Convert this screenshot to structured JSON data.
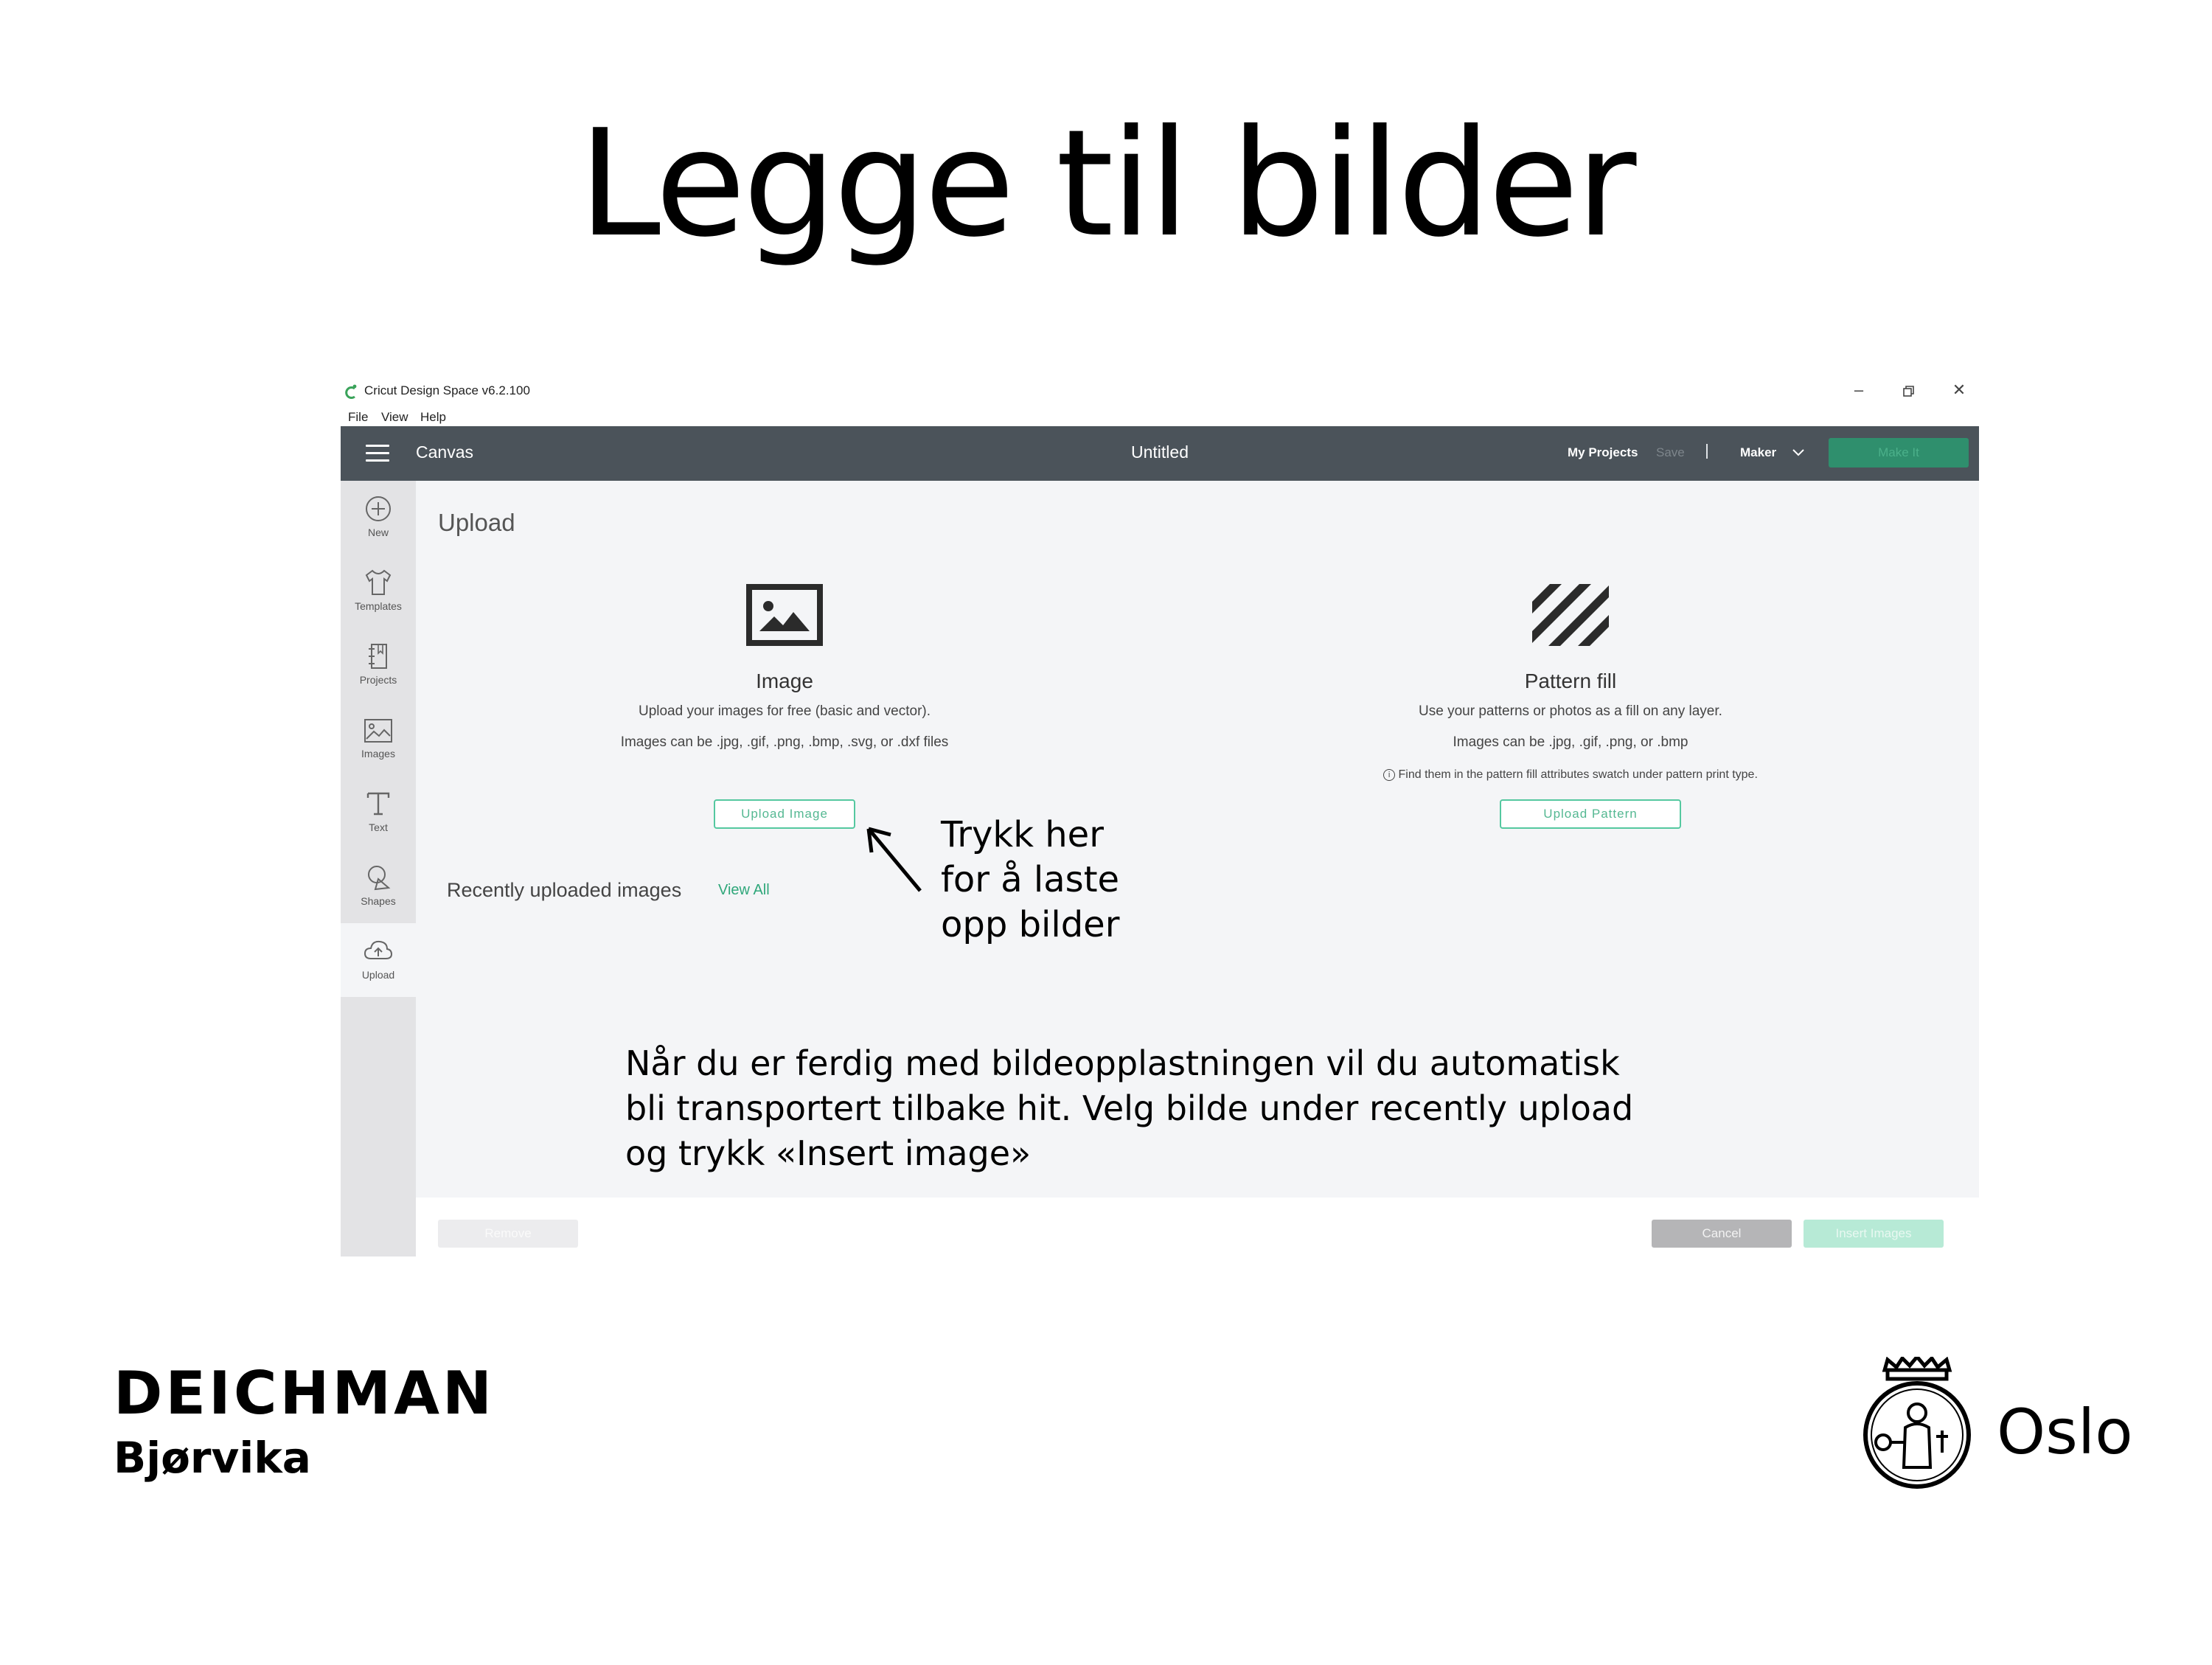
{
  "slide": {
    "title": "Legge til bilder"
  },
  "window": {
    "title": "Cricut Design Space  v6.2.100",
    "menu": [
      "File",
      "View",
      "Help"
    ]
  },
  "topbar": {
    "canvas_label": "Canvas",
    "doc_title": "Untitled",
    "my_projects": "My Projects",
    "save": "Save",
    "separator": "|",
    "machine": "Maker",
    "make_it": "Make It"
  },
  "sidebar": {
    "items": [
      {
        "label": "New",
        "icon": "plus-circle-icon"
      },
      {
        "label": "Templates",
        "icon": "shirt-icon"
      },
      {
        "label": "Projects",
        "icon": "notebook-icon"
      },
      {
        "label": "Images",
        "icon": "image-icon"
      },
      {
        "label": "Text",
        "icon": "text-icon"
      },
      {
        "label": "Shapes",
        "icon": "shapes-icon"
      },
      {
        "label": "Upload",
        "icon": "cloud-upload-icon"
      }
    ],
    "active": "Upload"
  },
  "upload": {
    "heading": "Upload",
    "image_card": {
      "title": "Image",
      "line1": "Upload your images for free (basic and vector).",
      "line2": "Images can be .jpg, .gif, .png, .bmp, .svg, or .dxf files",
      "button": "Upload Image"
    },
    "pattern_card": {
      "title": "Pattern fill",
      "line1": "Use your patterns or photos as a fill on any layer.",
      "line2": "Images can be .jpg, .gif, .png, or .bmp",
      "note_icon": "info-icon",
      "note": "Find them in the pattern fill attributes swatch under pattern print type.",
      "button": "Upload Pattern"
    },
    "recent_label": "Recently uploaded images",
    "view_all": "View All"
  },
  "footer": {
    "remove": "Remove",
    "cancel": "Cancel",
    "insert": "Insert Images"
  },
  "annotations": {
    "arrow_note": [
      "Trykk her",
      "for å laste",
      "opp bilder"
    ],
    "bottom_note": [
      "Når du er ferdig med bildeopplastningen vil du automatisk",
      "bli transportert tilbake hit. Velg bilde under recently upload",
      "og trykk «Insert image»"
    ]
  },
  "branding": {
    "left_name": "DEICHMAN",
    "left_sub": "Bjørvika",
    "right_name": "Oslo"
  },
  "colors": {
    "topbar": "#4b535a",
    "accent_green": "#55c8a0",
    "sidebar": "#e3e3e5",
    "main_bg": "#f4f5f7"
  }
}
